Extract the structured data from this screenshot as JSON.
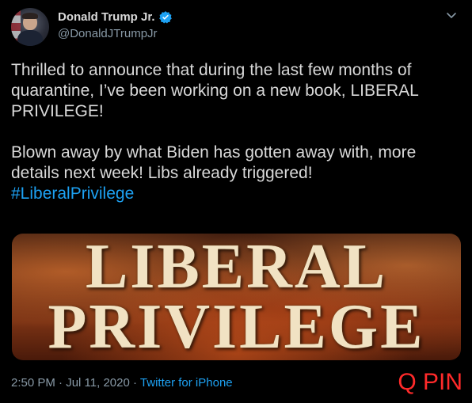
{
  "author": {
    "display_name": "Donald Trump Jr.",
    "handle": "@DonaldJTrumpJr",
    "verified_icon": "verified-badge-icon",
    "avatar_icon": "profile-avatar"
  },
  "menu": {
    "icon": "chevron-down-icon"
  },
  "tweet": {
    "line1": "Thrilled to announce that during the last few months of quarantine, I’ve  been working on a new book, LIBERAL PRIVILEGE!",
    "line2": "Blown away by what Biden has gotten away with, more details next week! Libs already triggered!",
    "hashtag": "#LiberalPrivilege"
  },
  "media": {
    "title_line1": "LIBERAL",
    "title_line2": "PRIVILEGE"
  },
  "meta": {
    "time": "2:50 PM",
    "separator1": " · ",
    "date": "Jul 11, 2020",
    "separator2": " · ",
    "source": "Twitter for iPhone"
  },
  "watermark": "Q PIN",
  "colors": {
    "background": "#000000",
    "text": "#d9d9d9",
    "muted": "#8899a6",
    "link": "#1da1f2",
    "watermark": "#ff2a2a"
  }
}
